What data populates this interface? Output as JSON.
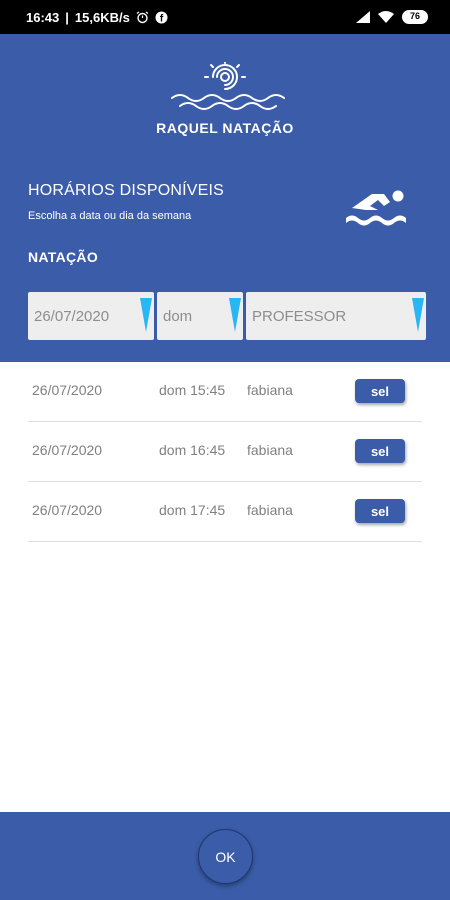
{
  "status": {
    "time": "16:43",
    "speed": "15,6KB/s",
    "battery": "76"
  },
  "header": {
    "brand": "RAQUEL NATAÇÃO",
    "title": "HORÁRIOS DISPONÍVEIS",
    "subtitle": "Escolha a data ou dia da semana",
    "section": "NATAÇÃO"
  },
  "filters": {
    "date": "26/07/2020",
    "day": "dom",
    "professor": "PROFESSOR"
  },
  "rows": [
    {
      "date": "26/07/2020",
      "time": "dom 15:45",
      "professor": "fabiana",
      "action": "sel"
    },
    {
      "date": "26/07/2020",
      "time": "dom 16:45",
      "professor": "fabiana",
      "action": "sel"
    },
    {
      "date": "26/07/2020",
      "time": "dom 17:45",
      "professor": "fabiana",
      "action": "sel"
    }
  ],
  "footer": {
    "ok_label": "OK"
  },
  "colors": {
    "primary": "#3b5ca8",
    "accent": "#29b6f6"
  },
  "icons": [
    "alarm-icon",
    "facebook-icon",
    "signal-icon",
    "wifi-icon",
    "battery-icon",
    "sun-waves-logo-icon",
    "swimmer-icon",
    "dropdown-arrow-icon"
  ]
}
